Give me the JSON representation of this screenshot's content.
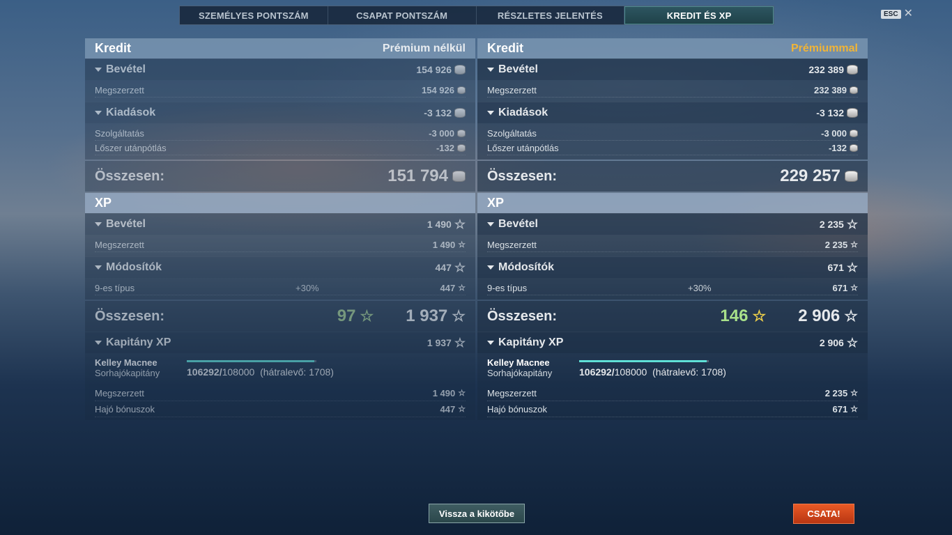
{
  "tabs": [
    {
      "label": "SZEMÉLYES PONTSZÁM",
      "active": false
    },
    {
      "label": "CSAPAT PONTSZÁM",
      "active": false
    },
    {
      "label": "RÉSZLETES JELENTÉS",
      "active": false
    },
    {
      "label": "KREDIT ÉS XP",
      "active": true
    }
  ],
  "esc": {
    "key": "ESC",
    "close": "✕"
  },
  "left": {
    "credit": {
      "title": "Kredit",
      "subtitle": "Prémium nélkül",
      "income": {
        "label": "Bevétel",
        "value": "154 926",
        "rows": [
          {
            "label": "Megszerzett",
            "value": "154 926"
          }
        ]
      },
      "expenses": {
        "label": "Kiadások",
        "value": "-3 132",
        "rows": [
          {
            "label": "Szolgáltatás",
            "value": "-3 000"
          },
          {
            "label": "Lőszer utánpótlás",
            "value": "-132"
          }
        ]
      },
      "total": {
        "label": "Összesen:",
        "value": "151 794"
      }
    },
    "xp": {
      "title": "XP",
      "income": {
        "label": "Bevétel",
        "value": "1 490",
        "rows": [
          {
            "label": "Megszerzett",
            "value": "1 490"
          }
        ]
      },
      "modifiers": {
        "label": "Módosítók",
        "value": "447",
        "rows": [
          {
            "label": "9-es típus",
            "modifier": "+30%",
            "value": "447"
          }
        ]
      },
      "total": {
        "label": "Összesen:",
        "bonus": "97",
        "value": "1 937"
      },
      "captain": {
        "label": "Kapitány XP",
        "value": "1 937",
        "name": "Kelley Macnee",
        "rank": "Sorhajókapitány",
        "current": "106292/",
        "max": "108000",
        "remaining": "(hátralevő: 1708)",
        "progress": 0.984,
        "rows": [
          {
            "label": "Megszerzett",
            "value": "1 490"
          },
          {
            "label": "Hajó bónuszok",
            "value": "447"
          }
        ]
      }
    }
  },
  "right": {
    "credit": {
      "title": "Kredit",
      "subtitle": "Prémiummal",
      "income": {
        "label": "Bevétel",
        "value": "232 389",
        "rows": [
          {
            "label": "Megszerzett",
            "value": "232 389"
          }
        ]
      },
      "expenses": {
        "label": "Kiadások",
        "value": "-3 132",
        "rows": [
          {
            "label": "Szolgáltatás",
            "value": "-3 000"
          },
          {
            "label": "Lőszer utánpótlás",
            "value": "-132"
          }
        ]
      },
      "total": {
        "label": "Összesen:",
        "value": "229 257"
      }
    },
    "xp": {
      "title": "XP",
      "income": {
        "label": "Bevétel",
        "value": "2 235",
        "rows": [
          {
            "label": "Megszerzett",
            "value": "2 235"
          }
        ]
      },
      "modifiers": {
        "label": "Módosítók",
        "value": "671",
        "rows": [
          {
            "label": "9-es típus",
            "modifier": "+30%",
            "value": "671"
          }
        ]
      },
      "total": {
        "label": "Összesen:",
        "bonus": "146",
        "value": "2 906"
      },
      "captain": {
        "label": "Kapitány XP",
        "value": "2 906",
        "name": "Kelley Macnee",
        "rank": "Sorhajókapitány",
        "current": "106292/",
        "max": "108000",
        "remaining": "(hátralevő: 1708)",
        "progress": 0.984,
        "rows": [
          {
            "label": "Megszerzett",
            "value": "2 235"
          },
          {
            "label": "Hajó bónuszok",
            "value": "671"
          }
        ]
      }
    }
  },
  "buttons": {
    "port": "Vissza a kikötőbe",
    "battle": "CSATA!"
  },
  "icons": {
    "credit": "credit-coin-icon",
    "xp": "xp-star-icon",
    "collapse": "triangle-down-icon"
  },
  "colors": {
    "premium": "#f0b437",
    "bonus_xp": "#a8e08a",
    "battle": "#d8461a",
    "progress": "#5fe0d6"
  }
}
